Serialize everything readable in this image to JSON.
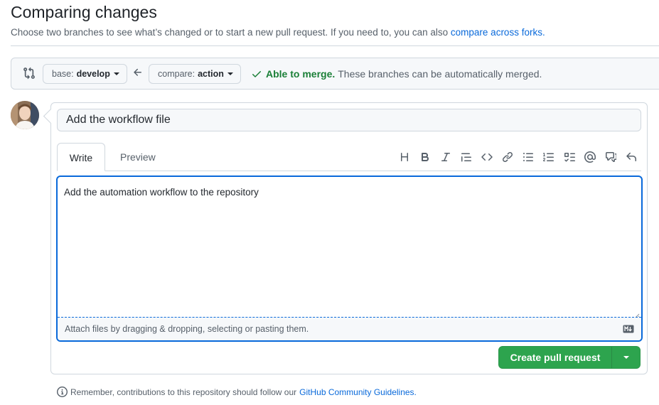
{
  "header": {
    "title": "Comparing changes",
    "subtitle": "Choose two branches to see what’s changed or to start a new pull request. If you need to, you can also",
    "compare_forks_link": "compare across forks."
  },
  "range": {
    "base_prefix": "base:",
    "base_branch": "develop",
    "compare_prefix": "compare:",
    "compare_branch": "action",
    "merge_status_bold": "Able to merge.",
    "merge_status_text": "These branches can be automatically merged."
  },
  "form": {
    "title_value": "Add the workflow file",
    "tabs": [
      "Write",
      "Preview"
    ],
    "toolbar_icons": [
      "heading-icon",
      "bold-icon",
      "italic-icon",
      "quote-icon",
      "code-icon",
      "link-icon",
      "unordered-list-icon",
      "ordered-list-icon",
      "task-list-icon",
      "mention-icon",
      "cross-reference-icon",
      "reply-icon"
    ],
    "body_value": "Add the automation workflow to the repository",
    "attach_text": "Attach files by dragging & dropping, selecting or pasting them.",
    "submit_label": "Create pull request"
  },
  "footer": {
    "guideline_text": "Remember, contributions to this repository should follow our",
    "guideline_link": "GitHub Community Guidelines."
  },
  "colors": {
    "accent": "#0969da",
    "success": "#1a7f37",
    "button_green": "#2da44e",
    "border": "#d0d7de"
  }
}
